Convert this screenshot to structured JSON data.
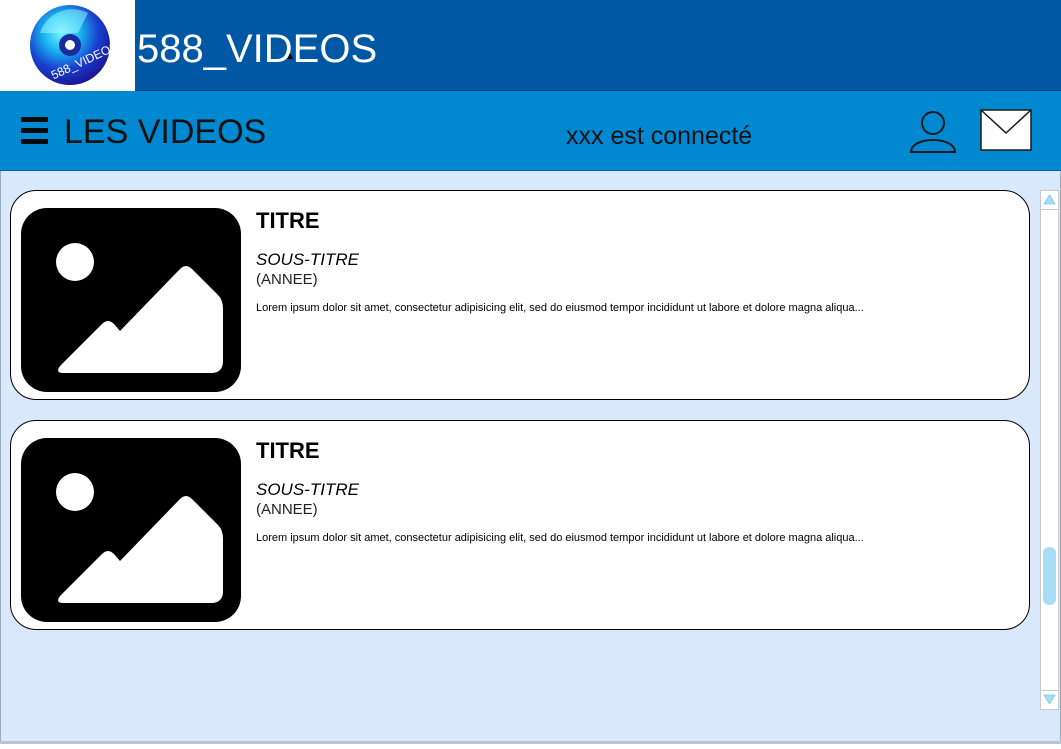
{
  "header": {
    "logo_text": "588_VIDEOS",
    "app_title": "588_VIDEOS"
  },
  "nav": {
    "menu_icon": "hamburger-icon",
    "title": "LES VIDEOS",
    "status": "xxx est connecté",
    "user_icon": "user-icon",
    "mail_icon": "mail-icon"
  },
  "videos": [
    {
      "title": "TITRE",
      "subtitle": "SOUS-TITRE",
      "year": "(ANNEE)",
      "description": "Lorem ipsum dolor sit amet, consectetur adipisicing elit, sed do eiusmod tempor incididunt ut labore et dolore magna aliqua...",
      "thumbnail_icon": "image-placeholder-icon"
    },
    {
      "title": "TITRE",
      "subtitle": "SOUS-TITRE",
      "year": "(ANNEE)",
      "description": "Lorem ipsum dolor sit amet, consectetur adipisicing elit, sed do eiusmod tempor incididunt ut labore et dolore magna aliqua...",
      "thumbnail_icon": "image-placeholder-icon"
    }
  ],
  "colors": {
    "header_bg": "#0057a3",
    "nav_bg": "#0088d1",
    "content_bg": "#dae8fc",
    "card_bg": "#ffffff",
    "scroll_thumb": "#a9dcf7"
  }
}
